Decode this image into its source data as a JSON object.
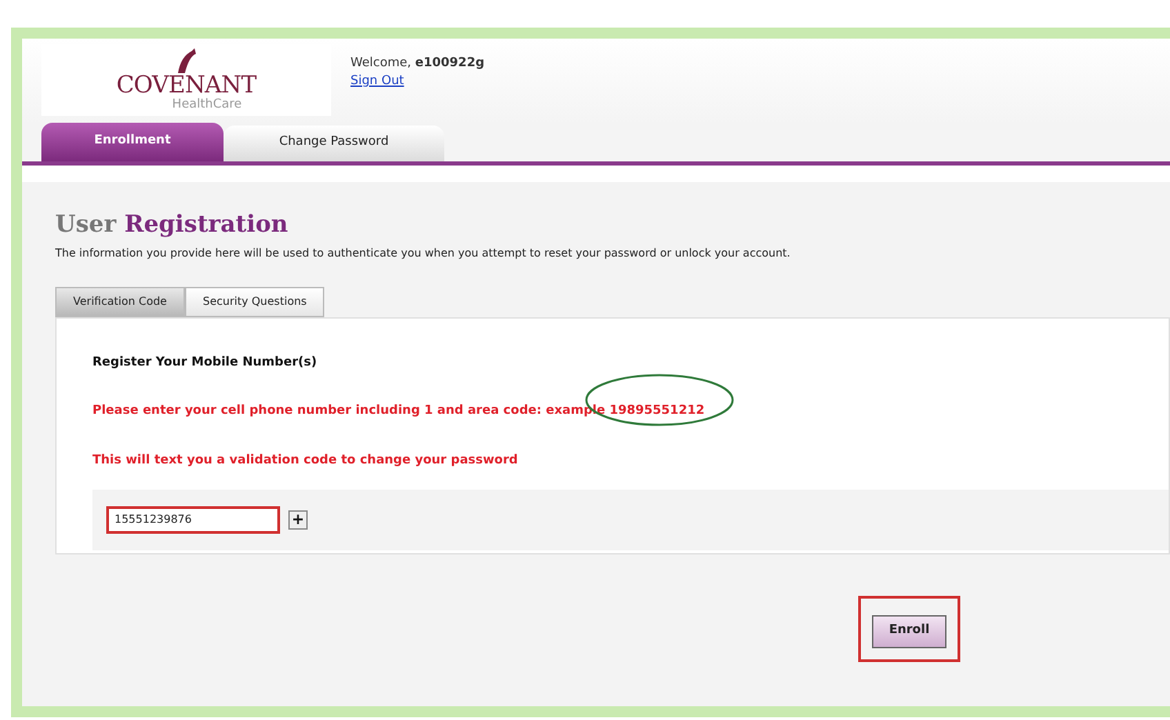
{
  "logo": {
    "name": "COVENANT",
    "tagline": "HealthCare"
  },
  "header": {
    "welcome": "Welcome,",
    "user": "e100922g",
    "sign_out": "Sign Out"
  },
  "tabs": [
    {
      "label": "Enrollment",
      "selected": true
    },
    {
      "label": "Change Password",
      "selected": false
    }
  ],
  "heading": {
    "light": "User",
    "strong": "Registration"
  },
  "description": "The information you provide here will be used to authenticate you when you attempt to reset your password or unlock your account.",
  "subtabs": [
    {
      "label": "Verification Code",
      "selected": true
    },
    {
      "label": "Security Questions",
      "selected": false
    }
  ],
  "section_title": "Register Your Mobile Number(s)",
  "instructions": [
    {
      "text": "Please enter your cell phone number including 1 and area code: example 19895551212",
      "circled": true
    },
    {
      "text": "This will text you a validation code to change your password",
      "circled": false
    }
  ],
  "phone_field": {
    "value": "15551239876",
    "highlighted": true
  },
  "add_button": {
    "label": "+"
  },
  "enroll_button": {
    "label": "Enroll",
    "highlighted": true
  }
}
